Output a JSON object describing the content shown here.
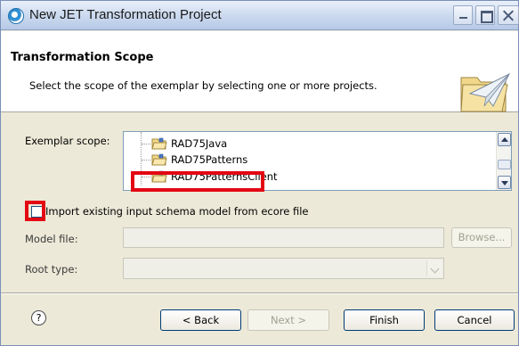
{
  "window": {
    "title": "New JET Transformation Project"
  },
  "banner": {
    "title": "Transformation Scope",
    "description": "Select the scope of the exemplar by selecting one or more projects."
  },
  "scope": {
    "label": "Exemplar scope:",
    "projects": [
      "RAD75Java",
      "RAD75Patterns",
      "RAD75PatternsClient"
    ]
  },
  "import_option": {
    "label": "Import existing input schema model from ecore file",
    "checked": false
  },
  "model_file": {
    "label": "Model file:",
    "value": "",
    "browse_label": "Browse..."
  },
  "root_type": {
    "label": "Root type:",
    "value": ""
  },
  "buttons": {
    "help": "?",
    "back": "< Back",
    "next": "Next >",
    "finish": "Finish",
    "cancel": "Cancel"
  },
  "colors": {
    "highlight_box": "#e30613",
    "dialog_background": "#ece9d8"
  }
}
